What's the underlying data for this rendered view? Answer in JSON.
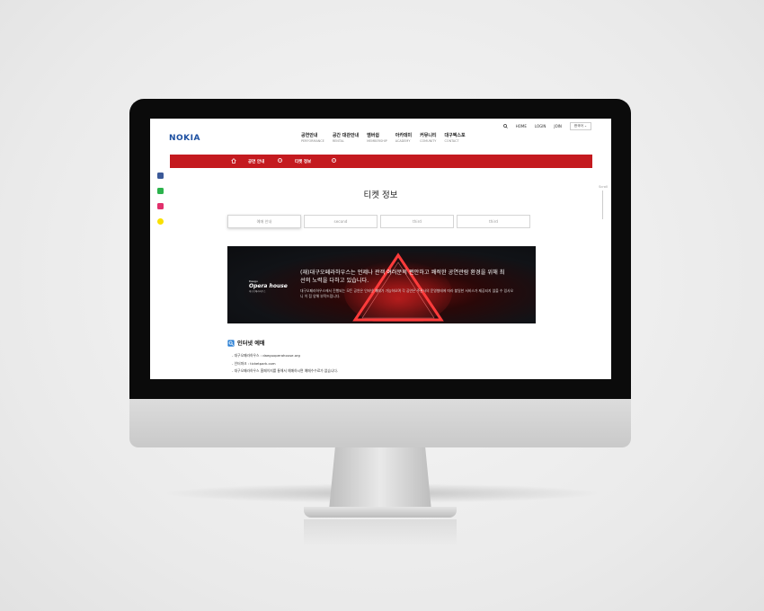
{
  "site": {
    "logo": "NOKIA"
  },
  "util": {
    "search_icon": "search-icon",
    "home": "HOME",
    "login": "LOGIN",
    "join": "JOIN",
    "lang": "한국어"
  },
  "gnb": [
    {
      "ko": "공연안내",
      "en": "PERFORMANCE"
    },
    {
      "ko": "공간 대관안내",
      "en": "RENTAL"
    },
    {
      "ko": "멤버쉽",
      "en": "MEMBERSHIP"
    },
    {
      "ko": "아카데미",
      "en": "ACADEMY"
    },
    {
      "ko": "커뮤니티",
      "en": "COMUNITY"
    },
    {
      "ko": "대구벡스포",
      "en": "CONTACT"
    }
  ],
  "breadcrumb": {
    "level1": "공연 안내",
    "level2": "티켓 정보"
  },
  "side": {
    "scroll": "Scroll"
  },
  "page": {
    "title": "티켓 정보"
  },
  "tabs": [
    "예매 안내",
    "second",
    "third",
    "third"
  ],
  "banner": {
    "logo_small": "Daegu",
    "logo_main": "Opera house",
    "logo_sub": "대구오페라하우스",
    "headline": "(재)대구오페라하우스는 언제나 관객 여러분의 편안하고 쾌적한 공연관람 환경을 위해 최선의 노력을 다하고 있습니다.",
    "body": "대구오페라하우스에서 진행되는 모든 공연은 인터넷 예매가 가능하오며 각 공연은 주관사의 운영형태에 따라 할일한 서비스가 제공되지 않을 수 있사오니 이 점 양해 부탁드립니다."
  },
  "section": {
    "title": "인터넷 예매",
    "lines": [
      "- 대구오페라하우스 : daeguoperahouse.org",
      "- 인터파크 : ticketpark.com",
      "- 대구오페라하우스 홈페이지를 통해서 예매하시면 예매수수료가 없습니다."
    ]
  },
  "colors": {
    "accent": "#c41a1f",
    "logo": "#1c4fa0",
    "facebook": "#3b5998",
    "line": "#2bb24c",
    "instagram": "#e1306c",
    "kakao": "#f9e000"
  }
}
